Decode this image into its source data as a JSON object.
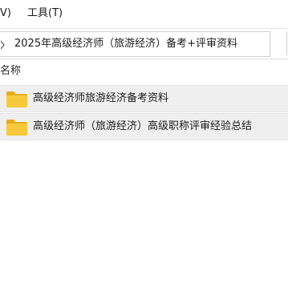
{
  "menubar": {
    "view_label": "V)",
    "tools_label": "工具(T)"
  },
  "addressbar": {
    "crumb": "2025年高级经济师（旅游经济）备考+评审资料"
  },
  "columns": {
    "name_header": "名称"
  },
  "files": [
    {
      "name": "高级经济师旅游经济备考资料",
      "icon": "folder-icon"
    },
    {
      "name": "高级经济师（旅游经济）高级职称评审经验总结",
      "icon": "folder-icon"
    }
  ],
  "colors": {
    "row_selected_bg": "#efefef",
    "folder_yellow": "#f8c93b"
  }
}
